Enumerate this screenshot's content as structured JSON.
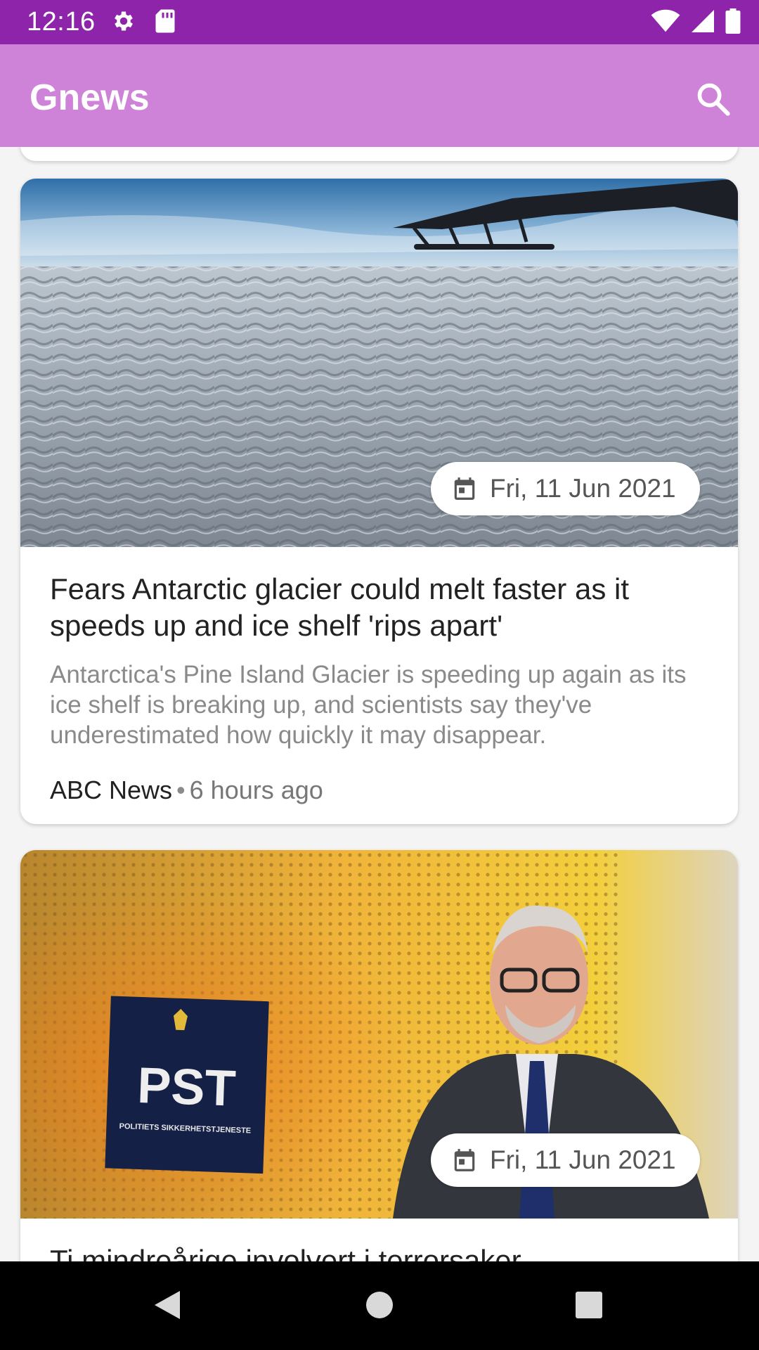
{
  "status_bar": {
    "time": "12:16",
    "left_icons": [
      "gear-icon",
      "sd-card-icon"
    ],
    "right_icons": [
      "wifi-icon",
      "signal-icon",
      "battery-icon"
    ]
  },
  "app_bar": {
    "title": "Gnews",
    "search_icon": "search-icon"
  },
  "articles": [
    {
      "date": "Fri, 11 Jun 2021",
      "title": "Fears Antarctic glacier could melt faster as it speeds up and ice shelf 'rips apart'",
      "description": "Antarctica's Pine Island Glacier is speeding up again as its ice shelf is breaking up, and scientists say they've underestimated how quickly it may disappear.",
      "source": "ABC News",
      "separator": "•",
      "time_ago": "6 hours ago"
    },
    {
      "date": "Fri, 11 Jun 2021",
      "title": "Ti mindreårige involvert i terrorsaker",
      "sign_text": "PST",
      "sign_subtext": "POLITIETS SIKKERHETSTJENESTE"
    }
  ],
  "nav_bar": {
    "buttons": [
      "back-icon",
      "home-icon",
      "recents-icon"
    ]
  },
  "colors": {
    "status_bar": "#8e24aa",
    "app_bar": "#ce83d8",
    "background": "#f4f4f4"
  }
}
